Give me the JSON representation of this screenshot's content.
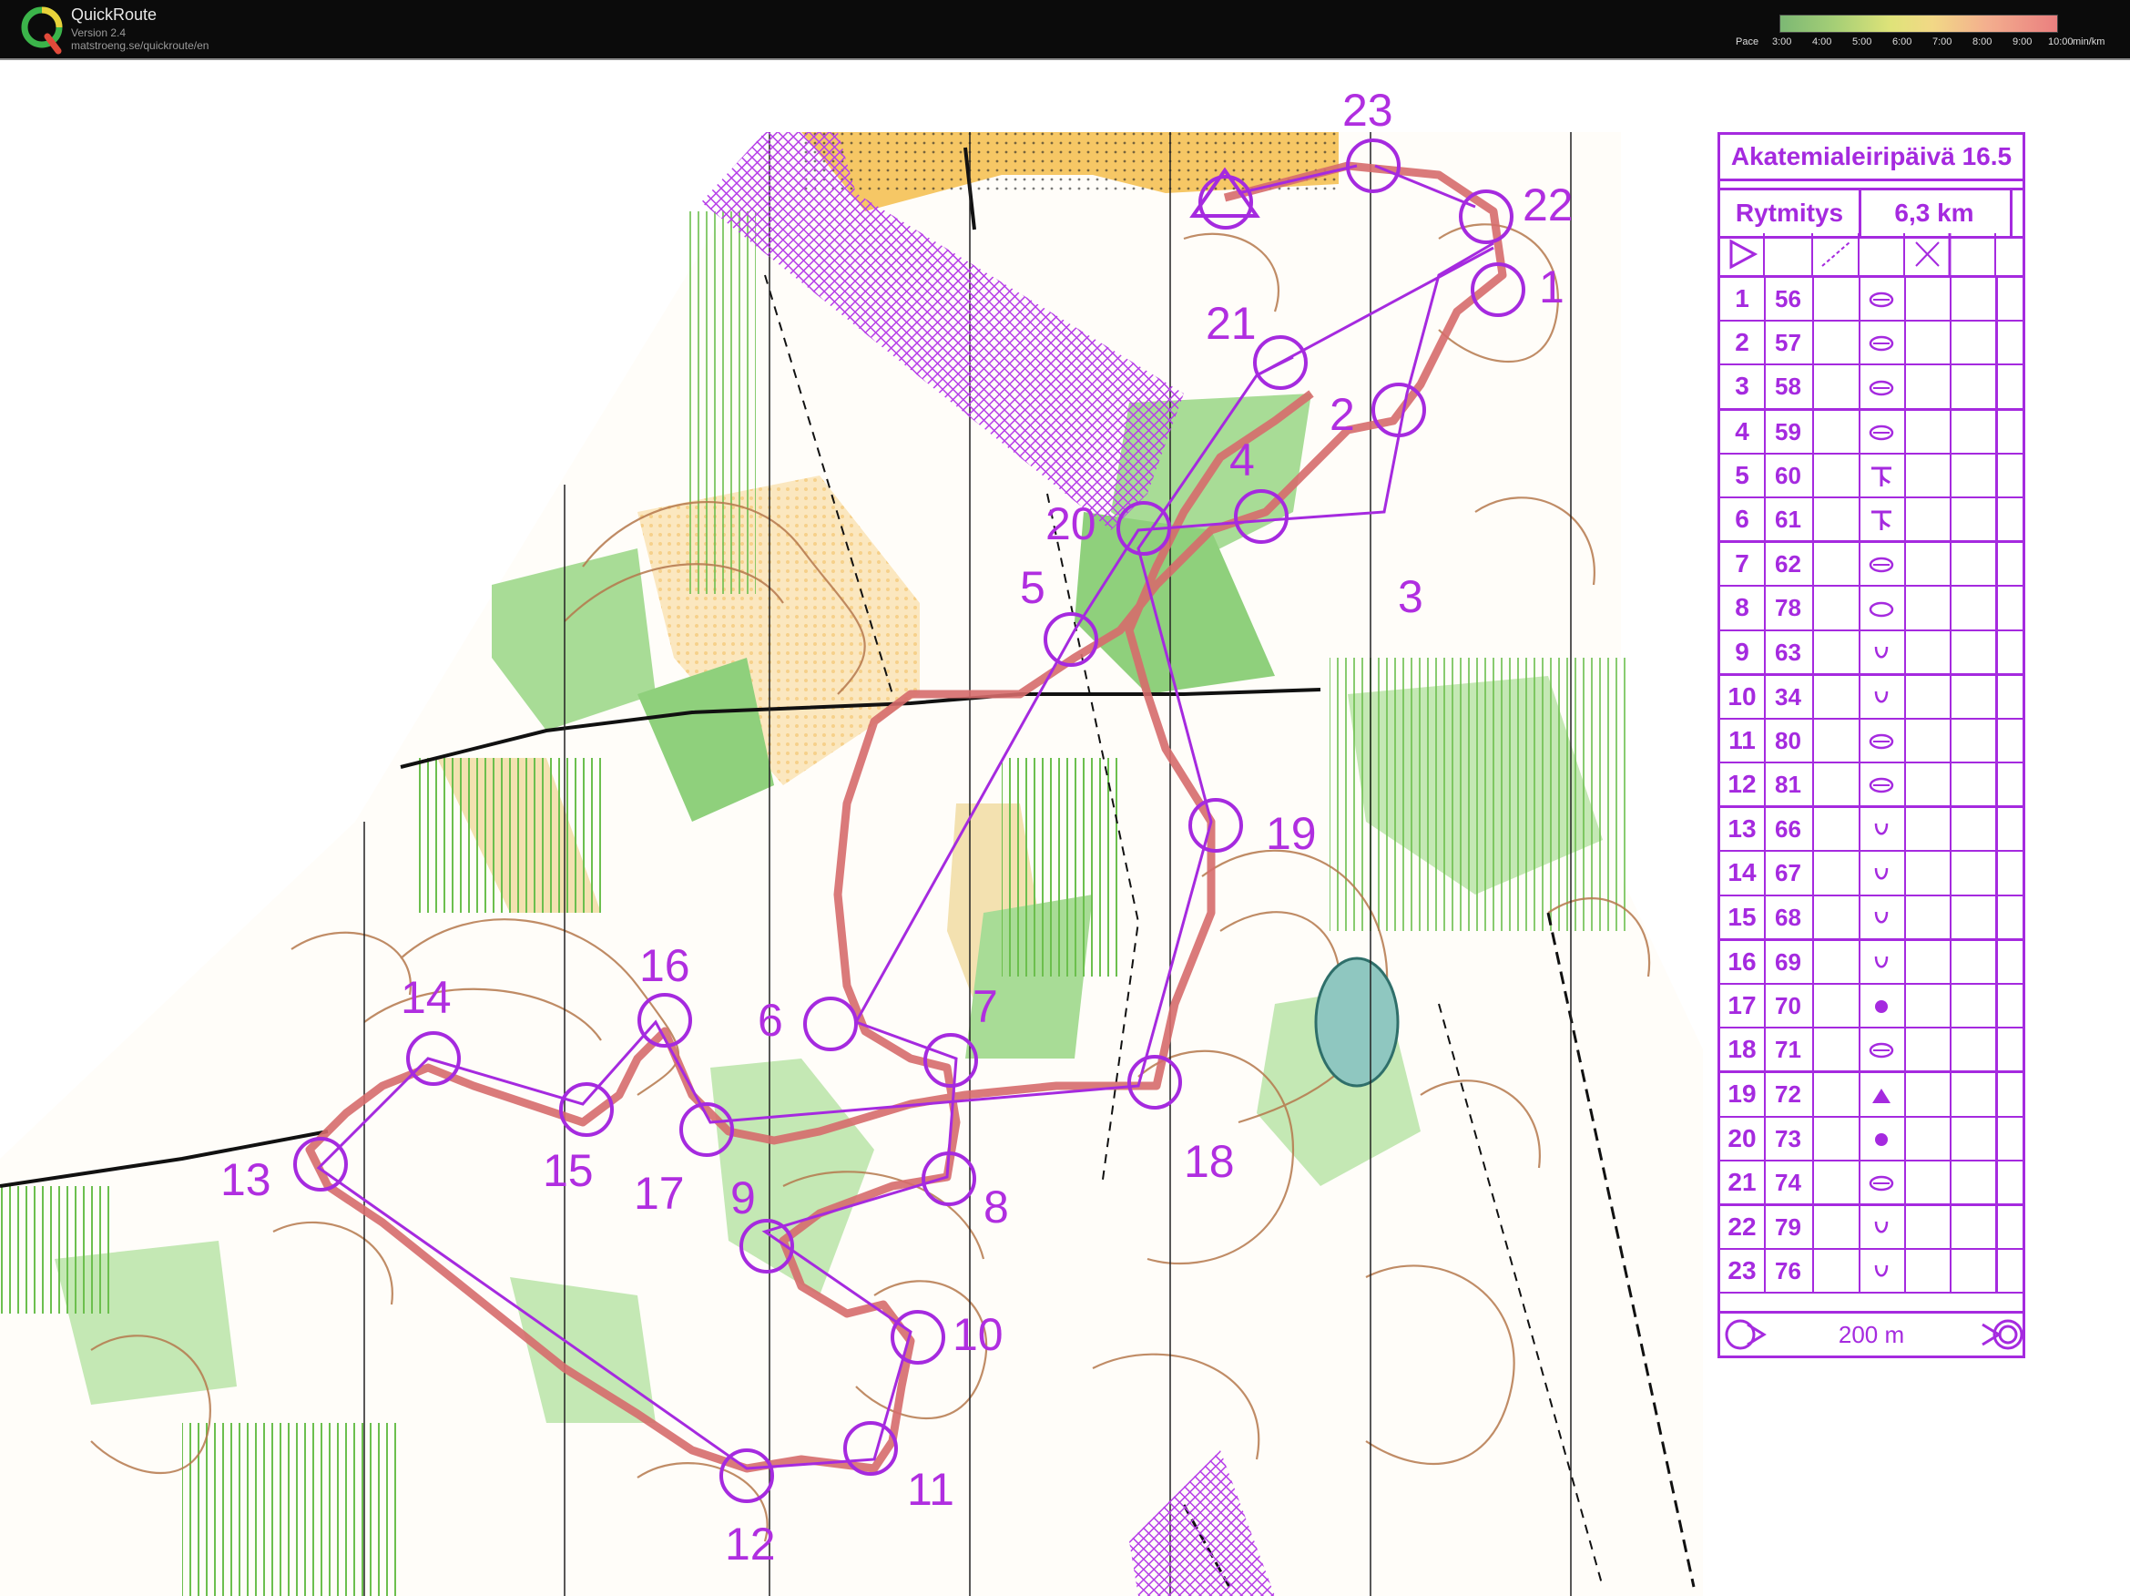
{
  "app": {
    "title": "QuickRoute",
    "version": "Version 2.4",
    "url": "matstroeng.se/quickroute/en"
  },
  "pace_legend": {
    "label": "Pace",
    "ticks": [
      "3:00",
      "4:00",
      "5:00",
      "6:00",
      "7:00",
      "8:00",
      "9:00",
      "10:00"
    ],
    "unit": "min/km"
  },
  "course_sheet": {
    "title": "Akatemialeiripäivä 16.5",
    "course_name": "Rytmitys",
    "length": "6,3 km",
    "finish_distance": "200 m",
    "controls": [
      {
        "num": "1",
        "code": "56",
        "symbol": "depression"
      },
      {
        "num": "2",
        "code": "57",
        "symbol": "depression"
      },
      {
        "num": "3",
        "code": "58",
        "symbol": "depression"
      },
      {
        "num": "4",
        "code": "59",
        "symbol": "depression"
      },
      {
        "num": "5",
        "code": "60",
        "symbol": "re-entrant"
      },
      {
        "num": "6",
        "code": "61",
        "symbol": "re-entrant"
      },
      {
        "num": "7",
        "code": "62",
        "symbol": "depression"
      },
      {
        "num": "8",
        "code": "78",
        "symbol": "hill"
      },
      {
        "num": "9",
        "code": "63",
        "symbol": "pit"
      },
      {
        "num": "10",
        "code": "34",
        "symbol": "pit"
      },
      {
        "num": "11",
        "code": "80",
        "symbol": "depression"
      },
      {
        "num": "12",
        "code": "81",
        "symbol": "depression"
      },
      {
        "num": "13",
        "code": "66",
        "symbol": "pit"
      },
      {
        "num": "14",
        "code": "67",
        "symbol": "pit"
      },
      {
        "num": "15",
        "code": "68",
        "symbol": "pit"
      },
      {
        "num": "16",
        "code": "69",
        "symbol": "pit"
      },
      {
        "num": "17",
        "code": "70",
        "symbol": "boulder"
      },
      {
        "num": "18",
        "code": "71",
        "symbol": "depression"
      },
      {
        "num": "19",
        "code": "72",
        "symbol": "rock"
      },
      {
        "num": "20",
        "code": "73",
        "symbol": "boulder"
      },
      {
        "num": "21",
        "code": "74",
        "symbol": "depression"
      },
      {
        "num": "22",
        "code": "79",
        "symbol": "pit"
      },
      {
        "num": "23",
        "code": "76",
        "symbol": "pit"
      }
    ]
  },
  "map_labels": [
    "1",
    "2",
    "3",
    "4",
    "5",
    "6",
    "7",
    "8",
    "9",
    "10",
    "11",
    "12",
    "13",
    "14",
    "15",
    "16",
    "17",
    "18",
    "19",
    "20",
    "21",
    "22",
    "23"
  ],
  "colors": {
    "course": "#a52adf",
    "route": "#d66b6b",
    "forest_green": "#8fd07c",
    "open_yellow": "#f6c765",
    "contour": "#b5784c"
  }
}
